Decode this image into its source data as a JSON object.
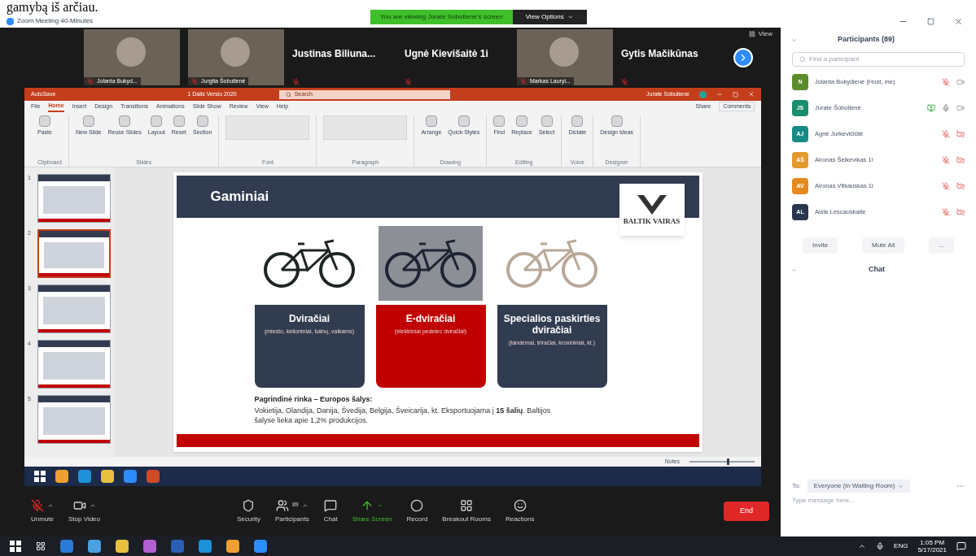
{
  "document_fragment": "gamybą iš arčiau.",
  "window": {
    "title": "Zoom Meeting 40-Minutes"
  },
  "share_banner": {
    "text": "You are viewing Jurate Sobutiene's screen",
    "button": "View Options"
  },
  "video_strip": {
    "tiles": [
      {
        "kind": "video",
        "name": "Jolanta Bukyd...",
        "muted": true
      },
      {
        "kind": "video",
        "name": "Jurgita Šobutienė",
        "muted": true
      },
      {
        "kind": "name",
        "name": "Justinas Biliuna...",
        "muted": true
      },
      {
        "kind": "name",
        "name": "Ugnė Kievišaitė 1i",
        "muted": true
      },
      {
        "kind": "video",
        "name": "Markas Lauryi...",
        "muted": true
      },
      {
        "kind": "name",
        "name": "Gytis Mačikūnas",
        "muted": true
      }
    ],
    "view_button": "View"
  },
  "powerpoint": {
    "title_bar": {
      "autosave": "AutoSave",
      "file": "1 Dalis Verslo 2020",
      "search": "Search",
      "user": "Jurate Sobutiene"
    },
    "tabs": [
      {
        "label": "File",
        "selected": false
      },
      {
        "label": "Home",
        "selected": true
      },
      {
        "label": "Insert",
        "selected": false
      },
      {
        "label": "Design",
        "selected": false
      },
      {
        "label": "Transitions",
        "selected": false
      },
      {
        "label": "Animations",
        "selected": false
      },
      {
        "label": "Slide Show",
        "selected": false
      },
      {
        "label": "Review",
        "selected": false
      },
      {
        "label": "View",
        "selected": false
      },
      {
        "label": "Help",
        "selected": false
      }
    ],
    "share": "Share",
    "comments": "Comments",
    "ribbon_groups": [
      {
        "label": "Clipboard",
        "buttons": [
          "Paste"
        ]
      },
      {
        "label": "Slides",
        "buttons": [
          "New Slide",
          "Reuse Slides",
          "Layout",
          "Reset",
          "Section"
        ]
      },
      {
        "label": "Font"
      },
      {
        "label": "Paragraph"
      },
      {
        "label": "Drawing",
        "buttons": [
          "Arrange",
          "Quick Styles"
        ]
      },
      {
        "label": "Editing",
        "buttons": [
          "Find",
          "Replace",
          "Select"
        ]
      },
      {
        "label": "Voice",
        "buttons": [
          "Dictate"
        ]
      },
      {
        "label": "Designer",
        "buttons": [
          "Design Ideas"
        ]
      }
    ],
    "thumbnails": [
      {
        "number": "1",
        "selected": false
      },
      {
        "number": "2",
        "selected": true
      },
      {
        "number": "3",
        "selected": false
      },
      {
        "number": "4",
        "selected": false
      },
      {
        "number": "5",
        "selected": false
      }
    ],
    "slide": {
      "title": "Gaminiai",
      "logo_text": "BALTIK VAIRAS",
      "products": [
        {
          "kind": "drawing",
          "name": "Dviračiai",
          "description": "(miesto, kelioniniai, kalnų, vaikams)",
          "color": "#323c50"
        },
        {
          "kind": "photo",
          "name": "E-dviračiai",
          "description": "(elektriniai pedelec dviračiai)",
          "color": "#c00000"
        },
        {
          "kind": "drawing",
          "name": "Specialios paskirties dviračiai",
          "description": "(tandemai, triračiai, krovininiai, kt.)",
          "color": "#323c50"
        }
      ],
      "market_heading": "Pagrindinė rinka – Europos šalys:",
      "market_text": "Vokietija, Olandija, Danija, Švedija, Belgija, Šveicarija, kt. Eksportuojama į **15 šalių**. Baltijos šalyse lieka apie 1,2% produkcijos."
    },
    "status_bar": {
      "notes": "Notes",
      "zoom": {
        "level": 0.6
      }
    }
  },
  "toolbar": {
    "items": [
      {
        "kind": "mic",
        "label": "Unmute",
        "caret": true
      },
      {
        "kind": "video",
        "label": "Stop Video",
        "caret": true
      },
      {
        "kind": "security",
        "label": "Security",
        "caret": false
      },
      {
        "kind": "participants",
        "label": "Participants",
        "caret": true,
        "badge": "89"
      },
      {
        "kind": "chat",
        "label": "Chat",
        "caret": false
      },
      {
        "kind": "share",
        "label": "Share Screen",
        "caret": true
      },
      {
        "kind": "record",
        "label": "Record",
        "caret": false
      },
      {
        "kind": "breakout",
        "label": "Breakout Rooms",
        "caret": false
      },
      {
        "kind": "reactions",
        "label": "Reactions",
        "caret": false
      }
    ],
    "end": "End"
  },
  "participants": {
    "title": "Participants (89)",
    "search_placeholder": "Find a participant",
    "people": [
      {
        "initials": "N",
        "name": "Jolanta Bukydienė (Host, me)",
        "color": "#5b8c2a",
        "muted": true,
        "camera_off": false,
        "sharing": false
      },
      {
        "initials": "JS",
        "name": "Jurate Šobutienė",
        "color": "#1a8f6e",
        "muted": false,
        "camera_off": false,
        "sharing": true
      },
      {
        "initials": "AJ",
        "name": "Agnė Jurkevičiūtė",
        "color": "#178a86",
        "muted": true,
        "camera_off": true,
        "sharing": false
      },
      {
        "initials": "AŠ",
        "name": "Aironas Šeikevikas 1i",
        "color": "#e39a2c",
        "muted": true,
        "camera_off": true,
        "sharing": false
      },
      {
        "initials": "AV",
        "name": "Aironas Vitkauskas 1i",
        "color": "#e58a1f",
        "muted": true,
        "camera_off": true,
        "sharing": false
      },
      {
        "initials": "AL",
        "name": "Aiste Lescauskaite",
        "color": "#2a3550",
        "muted": true,
        "camera_off": true,
        "sharing": false
      }
    ],
    "buttons": [
      "Invite",
      "Mute All",
      "..."
    ]
  },
  "chat": {
    "title": "Chat",
    "to_label": "To:",
    "recipient": "Everyone (in Waiting Room)",
    "placeholder": "Type message here..."
  },
  "taskbar": {
    "language": "ENG",
    "time": "1:05 PM",
    "date": "5/17/2021"
  }
}
